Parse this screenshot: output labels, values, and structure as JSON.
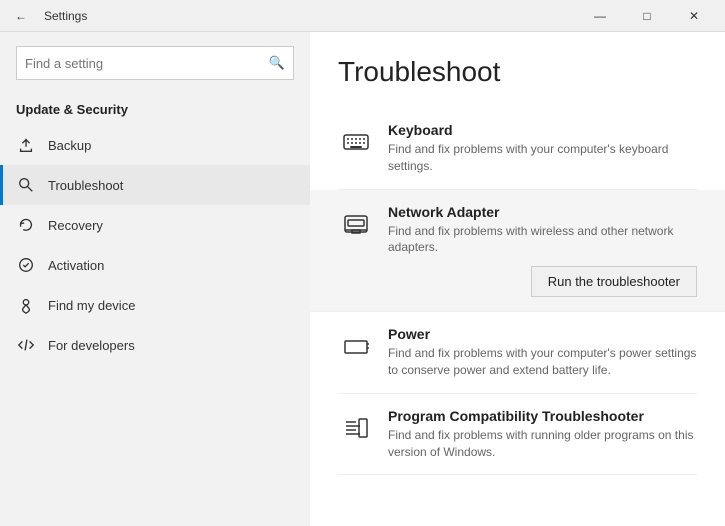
{
  "titleBar": {
    "title": "Settings",
    "minimize": "—",
    "maximize": "□",
    "close": "✕"
  },
  "sidebar": {
    "searchPlaceholder": "Find a setting",
    "sectionTitle": "Update & Security",
    "items": [
      {
        "id": "backup",
        "label": "Backup",
        "icon": "backup"
      },
      {
        "id": "troubleshoot",
        "label": "Troubleshoot",
        "icon": "troubleshoot",
        "active": true
      },
      {
        "id": "recovery",
        "label": "Recovery",
        "icon": "recovery"
      },
      {
        "id": "activation",
        "label": "Activation",
        "icon": "activation"
      },
      {
        "id": "find-my-device",
        "label": "Find my device",
        "icon": "find-device"
      },
      {
        "id": "for-developers",
        "label": "For developers",
        "icon": "developers"
      }
    ]
  },
  "content": {
    "title": "Troubleshoot",
    "items": [
      {
        "id": "keyboard",
        "name": "Keyboard",
        "desc": "Find and fix problems with your computer's keyboard settings.",
        "highlighted": false,
        "showBtn": false
      },
      {
        "id": "network-adapter",
        "name": "Network Adapter",
        "desc": "Find and fix problems with wireless and other network adapters.",
        "highlighted": true,
        "showBtn": true,
        "btnLabel": "Run the troubleshooter"
      },
      {
        "id": "power",
        "name": "Power",
        "desc": "Find and fix problems with your computer's power settings to conserve power and extend battery life.",
        "highlighted": false,
        "showBtn": false
      },
      {
        "id": "program-compatibility",
        "name": "Program Compatibility Troubleshooter",
        "desc": "Find and fix problems with running older programs on this version of Windows.",
        "highlighted": false,
        "showBtn": false
      }
    ]
  }
}
